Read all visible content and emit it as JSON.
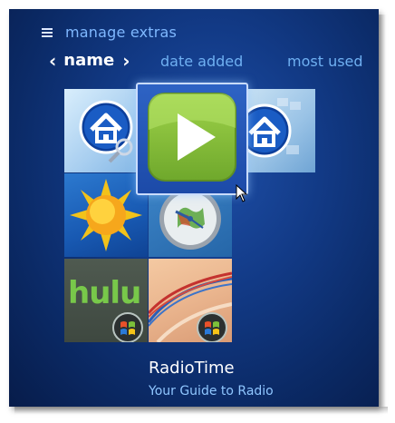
{
  "header": {
    "menu_icon": "hamburger-icon",
    "title": "manage extras"
  },
  "sort": {
    "prev_icon": "chevron-left-icon",
    "current": "name",
    "next_icon": "chevron-right-icon",
    "options": [
      "date added",
      "most used"
    ]
  },
  "gallery": {
    "tiles": [
      {
        "name": "home-search",
        "icon": "home-icon"
      },
      {
        "name": "play",
        "icon": "play-icon"
      },
      {
        "name": "home",
        "icon": "home-icon"
      },
      {
        "name": "sun",
        "icon": "sun-icon"
      },
      {
        "name": "clock",
        "icon": "clock-icon"
      },
      {
        "name": "hulu",
        "icon": "hulu-logo",
        "label": "hulu"
      },
      {
        "name": "art",
        "icon": "windows-logo"
      }
    ]
  },
  "caption": {
    "title": "RadioTime",
    "subtitle": "Your Guide to Radio"
  },
  "colors": {
    "background": "#123a86",
    "accent": "#7fb8ff",
    "tile_selected": "#8cc63f"
  }
}
